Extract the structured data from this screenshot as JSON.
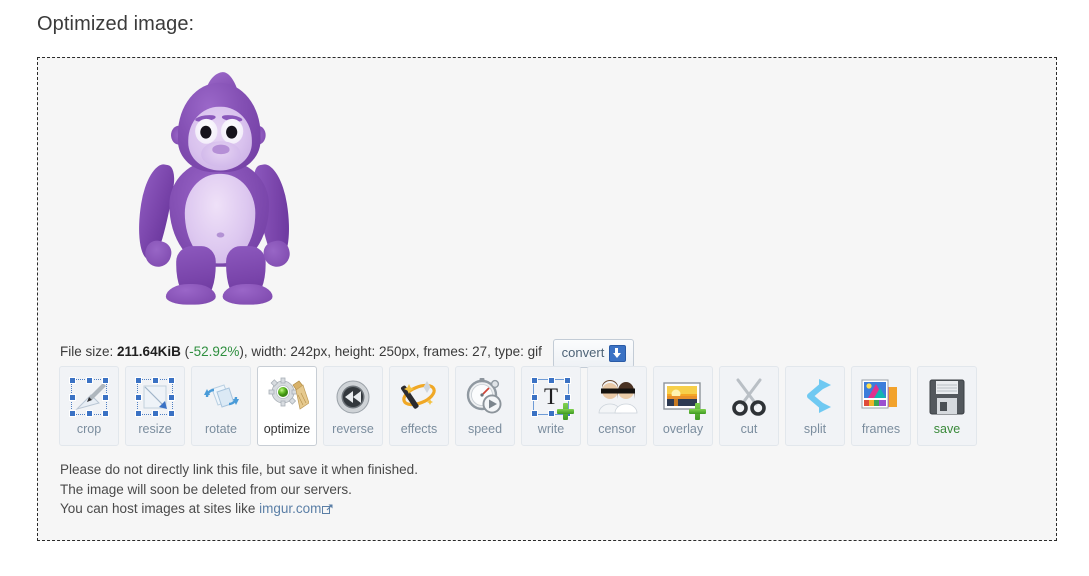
{
  "page_title": "Optimized image:",
  "file_info": {
    "label": "File size:",
    "size": "211.64KiB",
    "percent_open": "(",
    "percent": "-52.92%",
    "percent_close": "),",
    "width": "width: 242px,",
    "height": "height: 250px,",
    "frames": "frames: 27,",
    "type": "type: gif",
    "convert_label": "convert",
    "convert_icon": "download-icon"
  },
  "preview": {
    "alt": "optimized animated gif preview",
    "subject": "purple cartoon gorilla"
  },
  "toolbar": [
    {
      "id": "crop",
      "label": "crop",
      "icon": "crop-icon",
      "active": false
    },
    {
      "id": "resize",
      "label": "resize",
      "icon": "resize-icon",
      "active": false
    },
    {
      "id": "rotate",
      "label": "rotate",
      "icon": "rotate-icon",
      "active": false
    },
    {
      "id": "optimize",
      "label": "optimize",
      "icon": "optimize-icon",
      "active": true
    },
    {
      "id": "reverse",
      "label": "reverse",
      "icon": "reverse-icon",
      "active": false
    },
    {
      "id": "effects",
      "label": "effects",
      "icon": "effects-icon",
      "active": false
    },
    {
      "id": "speed",
      "label": "speed",
      "icon": "speed-icon",
      "active": false
    },
    {
      "id": "write",
      "label": "write",
      "icon": "write-icon",
      "active": false
    },
    {
      "id": "censor",
      "label": "censor",
      "icon": "censor-icon",
      "active": false
    },
    {
      "id": "overlay",
      "label": "overlay",
      "icon": "overlay-icon",
      "active": false
    },
    {
      "id": "cut",
      "label": "cut",
      "icon": "scissors-icon",
      "active": false
    },
    {
      "id": "split",
      "label": "split",
      "icon": "split-icon",
      "active": false
    },
    {
      "id": "frames",
      "label": "frames",
      "icon": "frames-icon",
      "active": false
    },
    {
      "id": "save",
      "label": "save",
      "icon": "floppy-icon",
      "active": false,
      "label_color": "green"
    }
  ],
  "notes": {
    "line1": "Please do not directly link this file, but save it when finished.",
    "line2": "The image will soon be deleted from our servers.",
    "line3_prefix": "You can host images at sites like ",
    "link_text": "imgur.com",
    "link_icon": "external-link-icon"
  },
  "colors": {
    "accent_green": "#2f8f3f",
    "save_green": "#3a8a3a",
    "link_blue": "#5b7fa6",
    "label_gray": "#7b8d9e",
    "panel_bg": "#f6f6f6",
    "panel_border": "#2b2b2b"
  }
}
